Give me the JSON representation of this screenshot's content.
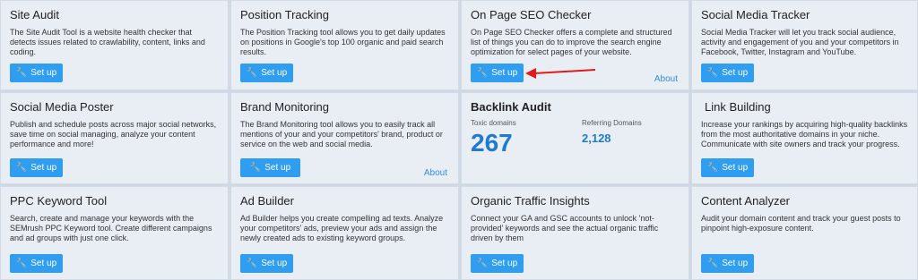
{
  "cards": {
    "site_audit": {
      "title": "Site Audit",
      "desc": "The Site Audit Tool is a website health checker that detects issues related to crawlability, content, links and coding.",
      "button": "Set up"
    },
    "position_tracking": {
      "title": "Position Tracking",
      "desc": "The Position Tracking tool allows you to get daily updates on positions in Google's top 100 organic and paid search results.",
      "button": "Set up"
    },
    "on_page_seo": {
      "title": "On Page SEO Checker",
      "desc": "On Page SEO Checker offers a complete and structured list of things you can do to improve the search engine optimization for select pages of your website.",
      "button": "Set up",
      "about": "About"
    },
    "social_media_tracker": {
      "title": "Social Media Tracker",
      "desc": "Social Media Tracker will let you track social audience, activity and engagement of you and your competitors in Facebook, Twitter, Instagram and YouTube.",
      "button": "Set up"
    },
    "social_media_poster": {
      "title": "Social Media Poster",
      "desc": "Publish and schedule posts across major social networks, save time on social managing, analyze your content performance and more!",
      "button": "Set up"
    },
    "brand_monitoring": {
      "title": "Brand Monitoring",
      "desc": "The Brand Monitoring tool allows you to easily track all mentions of your and your competitors' brand, product or service on the web and social media.",
      "button": "Set up",
      "about": "About"
    },
    "backlink_audit": {
      "title": "Backlink Audit",
      "toxic_label": "Toxic domains",
      "toxic_value": "267",
      "referring_label": "Referring Domains",
      "referring_value": "2,128"
    },
    "link_building": {
      "title": "Link Building",
      "desc": "Increase your rankings by acquiring high-quality backlinks from the most authoritative domains in your niche. Communicate with site owners and track your progress.",
      "button": "Set up"
    },
    "ppc_keyword": {
      "title": "PPC Keyword Tool",
      "desc": "Search, create and manage your keywords with the SEMrush PPC Keyword tool. Create different campaigns and ad groups with just one click.",
      "button": "Set up"
    },
    "ad_builder": {
      "title": "Ad Builder",
      "desc": "Ad Builder helps you create compelling ad texts. Analyze your competitors' ads, preview your ads and assign the newly created ads to existing keyword groups.",
      "button": "Set up"
    },
    "organic_traffic": {
      "title": "Organic Traffic Insights",
      "desc": "Connect your GA and GSC accounts to unlock 'not-provided' keywords and see the actual organic traffic driven by them",
      "button": "Set up"
    },
    "content_analyzer": {
      "title": "Content Analyzer",
      "desc": "Audit your domain content and track your guest posts to pinpoint high-exposure content.",
      "button": "Set up"
    }
  },
  "colors": {
    "accent": "#2f9df0",
    "arrow": "#e01b1b",
    "metric": "#1f7bd1"
  },
  "icons": {
    "setup": "wrench-icon"
  }
}
